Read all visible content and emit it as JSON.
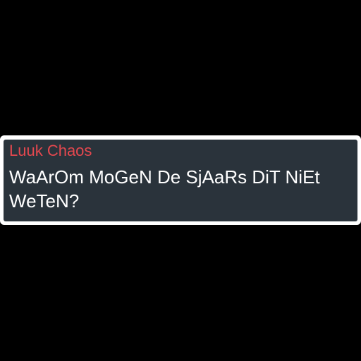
{
  "message": {
    "sender": "Luuk Chaos",
    "text": "WaArOm MoGeN De SjAaRs DiT NiEt WeTeN?"
  },
  "colors": {
    "background": "#000000",
    "border": "#ffffff",
    "bubble": "#2a333b",
    "sender": "#e5484f",
    "text": "#ffffff"
  }
}
